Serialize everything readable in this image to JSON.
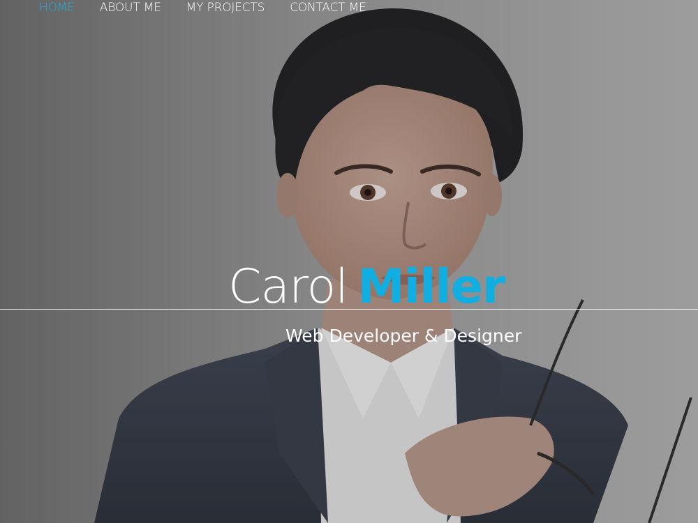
{
  "nav": {
    "items": [
      {
        "label": "HOME",
        "active": true
      },
      {
        "label": "ABOUT ME",
        "active": false
      },
      {
        "label": "MY PROJECTS",
        "active": false
      },
      {
        "label": "CONTACT ME",
        "active": false
      }
    ]
  },
  "hero": {
    "first_name": "Carol",
    "last_name": "Miller",
    "tagline": "Web Developer & Designer"
  },
  "colors": {
    "accent": "#11aee2",
    "text": "#ffffff"
  }
}
